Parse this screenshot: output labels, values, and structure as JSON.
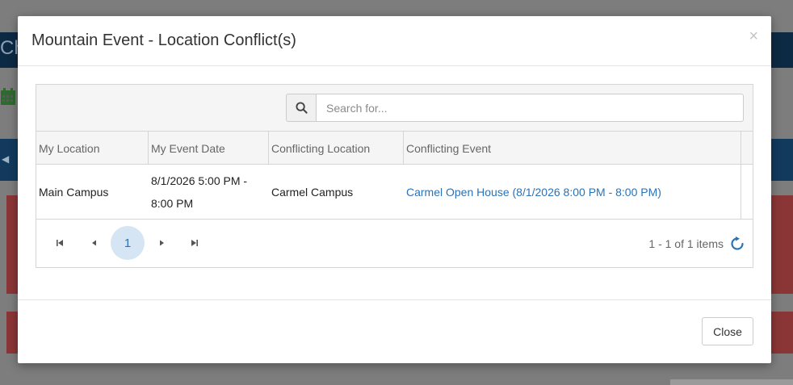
{
  "background": {
    "header_text": "Ch",
    "calendar_icon": "calendar-icon"
  },
  "modal": {
    "title": "Mountain Event - Location Conflict(s)",
    "close_x": "×",
    "close_button": "Close"
  },
  "search": {
    "placeholder": "Search for...",
    "value": ""
  },
  "table": {
    "columns": [
      "My Location",
      "My Event Date",
      "Conflicting Location",
      "Conflicting Event"
    ],
    "rows": [
      {
        "my_location": "Main Campus",
        "my_event_date": "8/1/2026 5:00 PM - 8:00 PM",
        "conflicting_location": "Carmel Campus",
        "conflicting_event": "Carmel Open House (8/1/2026 8:00 PM - 8:00 PM)"
      }
    ]
  },
  "pager": {
    "current_page": "1",
    "info": "1 - 1 of 1 items"
  },
  "colors": {
    "link": "#2b72b6",
    "navy": "#0d2a44",
    "danger": "#8b3636"
  }
}
